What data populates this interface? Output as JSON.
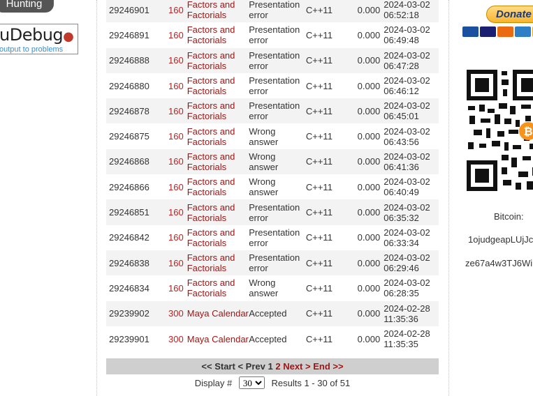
{
  "sidebar": {
    "hunting_label": "Hunting",
    "udebug_logo": "uDebug",
    "udebug_tagline": "output to problems"
  },
  "submissions": [
    {
      "id": "29246901",
      "problem_id": "160",
      "title": "Factors and Factorials",
      "verdict": "Presentation error",
      "lang": "C++11",
      "time": "0.000",
      "date": "2024-03-02",
      "clock": "06:52:18"
    },
    {
      "id": "29246891",
      "problem_id": "160",
      "title": "Factors and Factorials",
      "verdict": "Presentation error",
      "lang": "C++11",
      "time": "0.000",
      "date": "2024-03-02",
      "clock": "06:49:48"
    },
    {
      "id": "29246888",
      "problem_id": "160",
      "title": "Factors and Factorials",
      "verdict": "Presentation error",
      "lang": "C++11",
      "time": "0.000",
      "date": "2024-03-02",
      "clock": "06:47:28"
    },
    {
      "id": "29246880",
      "problem_id": "160",
      "title": "Factors and Factorials",
      "verdict": "Presentation error",
      "lang": "C++11",
      "time": "0.000",
      "date": "2024-03-02",
      "clock": "06:46:12"
    },
    {
      "id": "29246878",
      "problem_id": "160",
      "title": "Factors and Factorials",
      "verdict": "Presentation error",
      "lang": "C++11",
      "time": "0.000",
      "date": "2024-03-02",
      "clock": "06:45:01"
    },
    {
      "id": "29246875",
      "problem_id": "160",
      "title": "Factors and Factorials",
      "verdict": "Wrong answer",
      "lang": "C++11",
      "time": "0.000",
      "date": "2024-03-02",
      "clock": "06:43:56"
    },
    {
      "id": "29246868",
      "problem_id": "160",
      "title": "Factors and Factorials",
      "verdict": "Wrong answer",
      "lang": "C++11",
      "time": "0.000",
      "date": "2024-03-02",
      "clock": "06:41:36"
    },
    {
      "id": "29246866",
      "problem_id": "160",
      "title": "Factors and Factorials",
      "verdict": "Wrong answer",
      "lang": "C++11",
      "time": "0.000",
      "date": "2024-03-02",
      "clock": "06:40:49"
    },
    {
      "id": "29246851",
      "problem_id": "160",
      "title": "Factors and Factorials",
      "verdict": "Presentation error",
      "lang": "C++11",
      "time": "0.000",
      "date": "2024-03-02",
      "clock": "06:35:32"
    },
    {
      "id": "29246842",
      "problem_id": "160",
      "title": "Factors and Factorials",
      "verdict": "Presentation error",
      "lang": "C++11",
      "time": "0.000",
      "date": "2024-03-02",
      "clock": "06:33:34"
    },
    {
      "id": "29246838",
      "problem_id": "160",
      "title": "Factors and Factorials",
      "verdict": "Presentation error",
      "lang": "C++11",
      "time": "0.000",
      "date": "2024-03-02",
      "clock": "06:29:46"
    },
    {
      "id": "29246834",
      "problem_id": "160",
      "title": "Factors and Factorials",
      "verdict": "Wrong answer",
      "lang": "C++11",
      "time": "0.000",
      "date": "2024-03-02",
      "clock": "06:28:35"
    },
    {
      "id": "29239902",
      "problem_id": "300",
      "title": "Maya Calendar",
      "verdict": "Accepted",
      "lang": "C++11",
      "time": "0.000",
      "date": "2024-02-28",
      "clock": "11:35:36"
    },
    {
      "id": "29239901",
      "problem_id": "300",
      "title": "Maya Calendar",
      "verdict": "Accepted",
      "lang": "C++11",
      "time": "0.000",
      "date": "2024-02-28",
      "clock": "11:35:35"
    }
  ],
  "pagination": {
    "start": "<< Start",
    "prev": "< Prev",
    "page1": "1",
    "page2": "2",
    "next": "Next >",
    "end": "End >>"
  },
  "display": {
    "label": "Display #",
    "selected": "30",
    "results": "Results 1 - 30 of 51"
  },
  "donate": {
    "label": "Donate",
    "cards": [
      "Maestro",
      "VISA",
      "MC",
      "AMEX",
      "DISC"
    ]
  },
  "bitcoin": {
    "label": "Bitcoin:",
    "address_line1": "1ojudgeapLUjJc",
    "address_line2": "ze67a4w3TJ6Wi"
  },
  "colors": {
    "link_red": "#a01515",
    "row_alt": "#f3f3f3",
    "pager_bg": "#cfcfcf"
  }
}
